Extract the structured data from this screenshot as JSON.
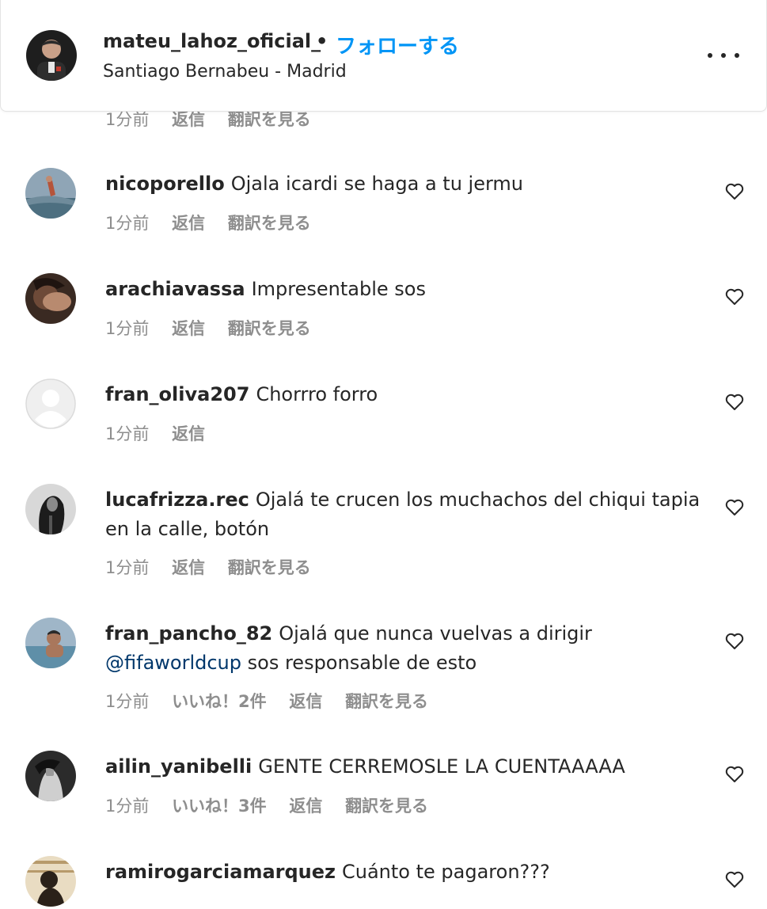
{
  "header": {
    "username": "mateu_lahoz_oficial_",
    "separator": "•",
    "follow_label": "フォローする",
    "location": "Santiago Bernabeu - Madrid",
    "more_icon": "more-options-icon"
  },
  "cut_comment": {
    "time": "1分前",
    "reply": "返信",
    "translate": "翻訳を見る"
  },
  "comments": [
    {
      "username": "nicoporello",
      "text": "Ojala icardi se haga a tu jermu",
      "time": "1分前",
      "likes": "",
      "reply": "返信",
      "translate": "翻訳を見る"
    },
    {
      "username": "arachiavassa",
      "text": "Impresentable sos",
      "time": "1分前",
      "likes": "",
      "reply": "返信",
      "translate": "翻訳を見る"
    },
    {
      "username": "fran_oliva207",
      "text": "Chorrro forro",
      "time": "1分前",
      "likes": "",
      "reply": "返信",
      "translate": ""
    },
    {
      "username": "lucafrizza.rec",
      "text": "Ojalá te crucen los muchachos del chiqui tapia en la calle, botón",
      "time": "1分前",
      "likes": "",
      "reply": "返信",
      "translate": "翻訳を見る"
    },
    {
      "username": "fran_pancho_82",
      "text": "Ojalá que nunca vuelvas a dirigir",
      "mention": "@fifaworldcup",
      "text_after": "sos responsable de esto",
      "time": "1分前",
      "likes": "いいね！2件",
      "reply": "返信",
      "translate": "翻訳を見る"
    },
    {
      "username": "ailin_yanibelli",
      "text": "GENTE CERREMOSLE LA CUENTAAAAA",
      "time": "1分前",
      "likes": "いいね！3件",
      "reply": "返信",
      "translate": "翻訳を見る"
    },
    {
      "username": "ramirogarciamarquez",
      "text": "Cuánto te pagaron???",
      "time": "",
      "likes": "",
      "reply": "",
      "translate": ""
    }
  ],
  "icons": {
    "like": "heart-icon"
  }
}
